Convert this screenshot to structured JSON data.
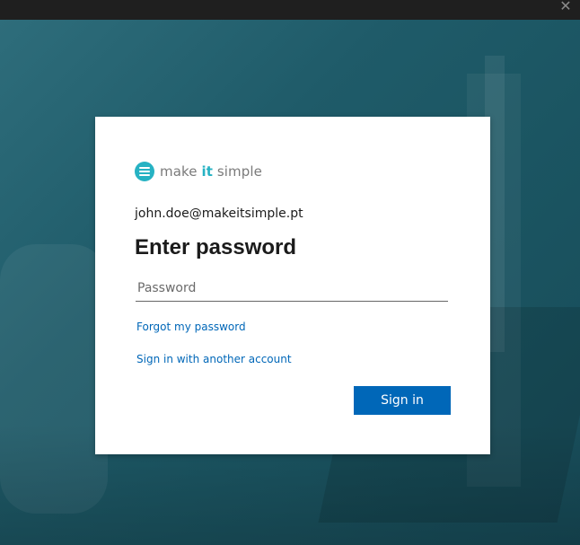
{
  "window": {
    "close_glyph": "✕"
  },
  "brand": {
    "prefix": "make ",
    "accent": "it",
    "suffix": " simple",
    "accent_color": "#26b2c3"
  },
  "signin": {
    "identity": "john.doe@makeitsimple.pt",
    "title": "Enter password",
    "password_placeholder": "Password",
    "password_value": "",
    "forgot_link": "Forgot my password",
    "other_account_link": "Sign in with another account",
    "submit_label": "Sign in",
    "link_color": "#0067b8",
    "button_color": "#0067b8"
  }
}
